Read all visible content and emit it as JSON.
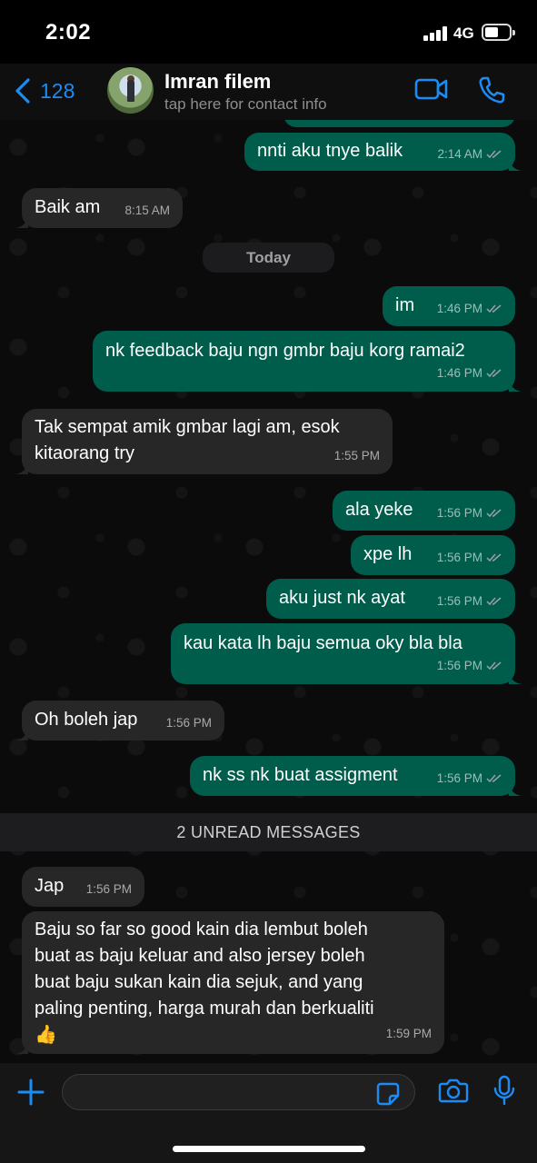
{
  "status_bar": {
    "time": "2:02",
    "network": "4G"
  },
  "header": {
    "back_count": "128",
    "contact_name": "Imran filem",
    "contact_subtitle": "tap here for contact info",
    "icons": {
      "back": "chevron-left-icon",
      "video": "video-camera-icon",
      "call": "phone-icon"
    }
  },
  "colors": {
    "accent": "#1c8cf5",
    "outgoing_bubble": "#005c4b",
    "incoming_bubble": "#272727",
    "read_ticks": "#9aa0a6"
  },
  "date_separator": "Today",
  "unread_banner": "2 UNREAD MESSAGES",
  "messages": [
    {
      "direction": "out",
      "lines": [
        "nnti aku tnye balik"
      ],
      "time": "2:14 AM",
      "status": "read"
    },
    {
      "direction": "in",
      "lines": [
        "Baik am"
      ],
      "time": "8:15 AM"
    },
    {
      "direction": "out",
      "lines": [
        "im"
      ],
      "time": "1:46 PM",
      "status": "read"
    },
    {
      "direction": "out",
      "lines": [
        "nk feedback baju ngn gmbr baju korg ramai2"
      ],
      "time": "1:46 PM",
      "status": "read"
    },
    {
      "direction": "in",
      "lines": [
        "Tak sempat amik gmbar lagi am, esok",
        "kitaorang try"
      ],
      "time": "1:55 PM"
    },
    {
      "direction": "out",
      "lines": [
        "ala yeke"
      ],
      "time": "1:56 PM",
      "status": "read"
    },
    {
      "direction": "out",
      "lines": [
        "xpe lh"
      ],
      "time": "1:56 PM",
      "status": "read"
    },
    {
      "direction": "out",
      "lines": [
        "aku just nk ayat"
      ],
      "time": "1:56 PM",
      "status": "read"
    },
    {
      "direction": "out",
      "lines": [
        "kau kata lh baju semua oky bla bla"
      ],
      "time": "1:56 PM",
      "status": "read"
    },
    {
      "direction": "in",
      "lines": [
        "Oh boleh jap"
      ],
      "time": "1:56 PM"
    },
    {
      "direction": "out",
      "lines": [
        "nk ss nk buat assigment"
      ],
      "time": "1:56 PM",
      "status": "read"
    },
    {
      "direction": "in",
      "lines": [
        "Jap"
      ],
      "time": "1:56 PM"
    },
    {
      "direction": "in",
      "lines": [
        "Baju so far so good kain dia lembut boleh",
        "buat as baju keluar and also jersey boleh",
        "buat baju sukan kain dia sejuk, and yang",
        "paling penting, harga murah dan berkualiti",
        "👍"
      ],
      "time": "1:59 PM"
    }
  ],
  "input_bar": {
    "icons": {
      "attach": "plus-icon",
      "sticker": "sticker-icon",
      "camera": "camera-icon",
      "mic": "microphone-icon"
    },
    "text_value": ""
  }
}
